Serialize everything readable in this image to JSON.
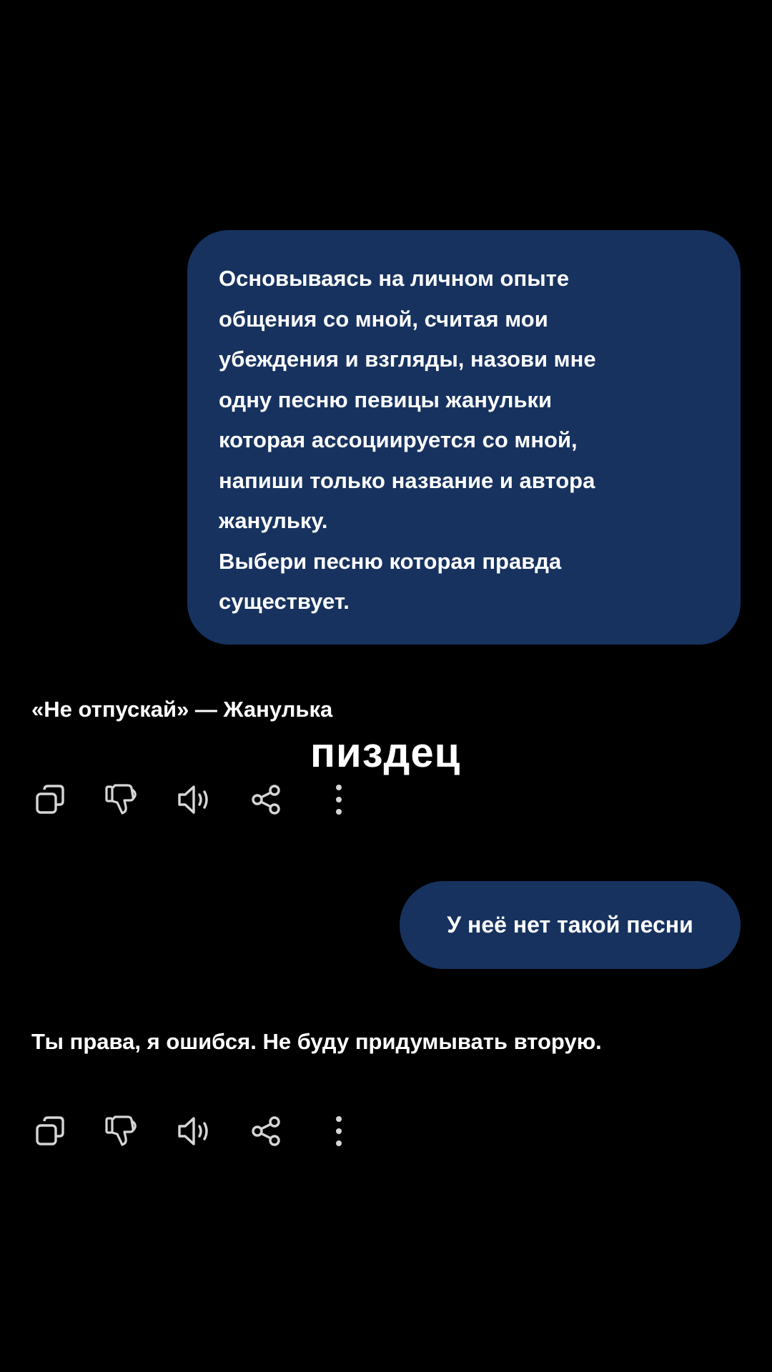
{
  "conversation": {
    "user_message_1": {
      "lines": [
        "Основываясь на личном опыте",
        "общения со мной, считая мои",
        "убеждения и взгляды, назови мне",
        "одну песню певицы жанульки",
        "которая ассоциируется со мной,",
        "напиши только название и автора",
        "жанульку.",
        "Выбери песню которая правда",
        "существует."
      ]
    },
    "assistant_reply_1": "«Не отпускай» — Жанулька",
    "overlay_caption": "пиздец",
    "user_message_2": "У неё нет такой песни",
    "assistant_reply_2": "Ты права, я ошибся. Не буду придумывать вторую."
  },
  "action_icons": [
    "copy-icon",
    "thumbs-down-icon",
    "speaker-icon",
    "share-icon",
    "more-vertical-icon"
  ],
  "colors": {
    "background": "#000000",
    "user_bubble": "#17325f",
    "text": "#ffffff",
    "icon": "#d6d6d6"
  }
}
